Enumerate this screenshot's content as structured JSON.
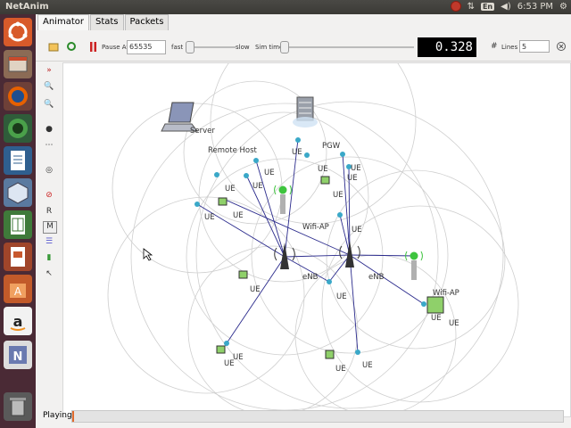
{
  "topbar": {
    "app_title": "NetAnim",
    "lang_badge": "En",
    "clock": "6:53 PM"
  },
  "tabs": [
    {
      "label": "Animator"
    },
    {
      "label": "Stats"
    },
    {
      "label": "Packets"
    }
  ],
  "toolbar": {
    "pause_label": "Pause At",
    "pause_value": "65535",
    "fast_label": "fast",
    "slow_label": "slow",
    "simtime_label": "Sim time",
    "sim_time": "0.328",
    "lines_label": "Lines",
    "lines_value": "5"
  },
  "left_tools": {
    "r_label": "R",
    "m_label": "M"
  },
  "canvas": {
    "node_labels": {
      "server": "Server",
      "remote_host": "Remote Host",
      "pgw": "PGW",
      "wifi_ap": "Wifi-AP",
      "enb": "eNB",
      "ue": "UE"
    }
  },
  "status": {
    "text": "Playing",
    "progress": 0.004
  },
  "colors": {
    "link": "#2a2a8c",
    "circle": "#cfcfcf",
    "ubuntu_orange": "#dd4814",
    "launcher": "#4a2a35"
  },
  "icons": [
    "ubuntu-logo-icon",
    "files-icon",
    "firefox-icon",
    "globe-icon",
    "writer-icon",
    "cube-icon",
    "calc-icon",
    "impress-icon",
    "software-center-icon",
    "amazon-icon",
    "netanim-icon",
    "trash-icon"
  ]
}
